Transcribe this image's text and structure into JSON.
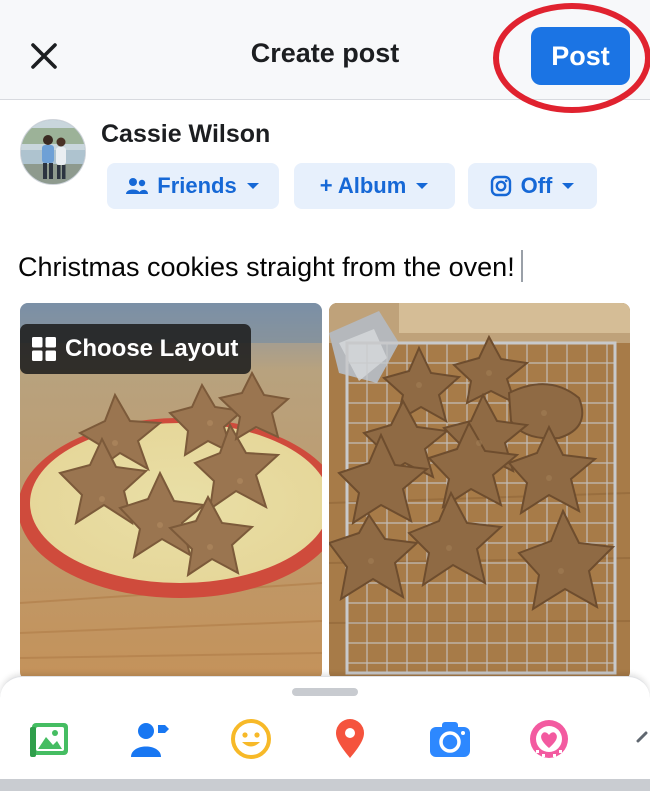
{
  "header": {
    "title": "Create post",
    "post_label": "Post"
  },
  "author": {
    "name": "Cassie Wilson"
  },
  "chips": {
    "audience": "Friends",
    "album": "+ Album",
    "instagram": "Off"
  },
  "composer": {
    "text": "Christmas cookies straight from the oven!"
  },
  "photos": {
    "choose_layout_label": "Choose Layout"
  },
  "toolbar": {
    "items": [
      "photo-video-icon",
      "tag-people-icon",
      "feeling-icon",
      "check-in-icon",
      "camera-icon",
      "gif-sticker-icon"
    ]
  },
  "colors": {
    "accent": "#1b74e4",
    "chip_bg": "#e7f0fc",
    "chip_text": "#1668d6",
    "annotation_ring": "#e0222f"
  }
}
